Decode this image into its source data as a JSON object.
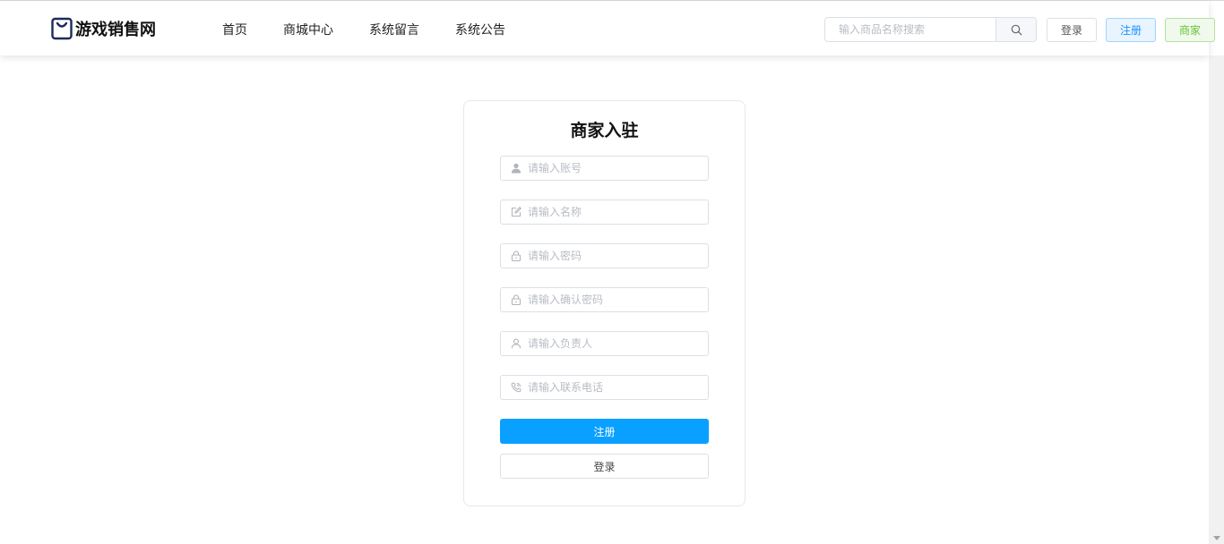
{
  "site": {
    "name": "游戏销售网",
    "logo_icon": "shopping-bag-icon"
  },
  "nav": [
    {
      "label": "首页"
    },
    {
      "label": "商城中心"
    },
    {
      "label": "系统留言"
    },
    {
      "label": "系统公告"
    }
  ],
  "search": {
    "placeholder": "输入商品名称搜索",
    "icon": "search-icon"
  },
  "header_buttons": {
    "login": "登录",
    "register": "注册",
    "merchant": "商家"
  },
  "colors": {
    "primary": "#0aa0ff",
    "register_text": "#1890ff",
    "merchant_text": "#67c23a"
  },
  "form": {
    "title": "商家入驻",
    "fields": [
      {
        "placeholder": "请输入账号",
        "icon": "user-filled-icon"
      },
      {
        "placeholder": "请输入名称",
        "icon": "edit-icon"
      },
      {
        "placeholder": "请输入密码",
        "icon": "lock-icon"
      },
      {
        "placeholder": "请输入确认密码",
        "icon": "lock-icon"
      },
      {
        "placeholder": "请输入负责人",
        "icon": "user-icon"
      },
      {
        "placeholder": "请输入联系电话",
        "icon": "phone-icon"
      }
    ],
    "submit_label": "注册",
    "login_label": "登录"
  }
}
